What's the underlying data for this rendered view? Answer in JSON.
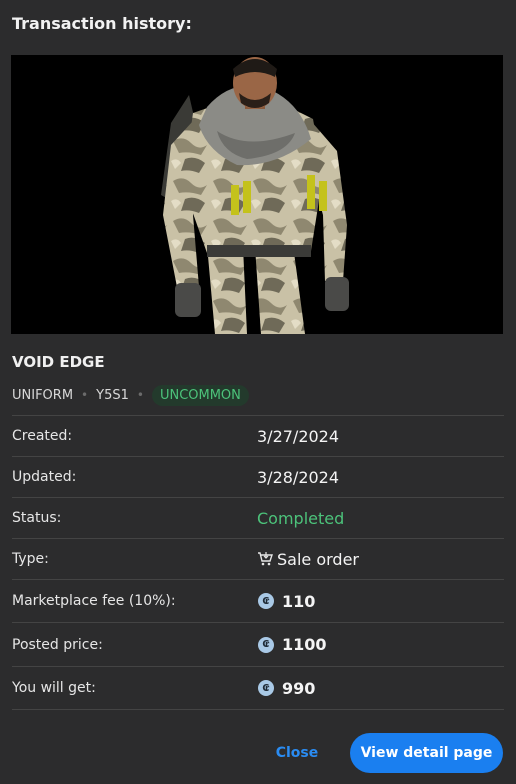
{
  "header": {
    "title": "Transaction history:"
  },
  "item": {
    "image_icon": "character-uniform-image",
    "name": "VOID EDGE",
    "tags": [
      "UNIFORM",
      "Y5S1"
    ],
    "rarity": "UNCOMMON",
    "rarity_color": "#4cc27a"
  },
  "details": {
    "created": {
      "label": "Created:",
      "value": "3/27/2024"
    },
    "updated": {
      "label": "Updated:",
      "value": "3/28/2024"
    },
    "status": {
      "label": "Status:",
      "value": "Completed",
      "color": "#4cc27a"
    },
    "type": {
      "label": "Type:",
      "value": "Sale order",
      "icon": "cart-icon"
    },
    "fee": {
      "label": "Marketplace fee (10%):",
      "value": "110",
      "icon": "credit-coin-icon"
    },
    "posted": {
      "label": "Posted price:",
      "value": "1100",
      "icon": "credit-coin-icon"
    },
    "get": {
      "label": "You will get:",
      "value": "990",
      "icon": "credit-coin-icon"
    }
  },
  "actions": {
    "close_label": "Close",
    "detail_label": "View detail page",
    "accent": "#1a7ff0"
  }
}
